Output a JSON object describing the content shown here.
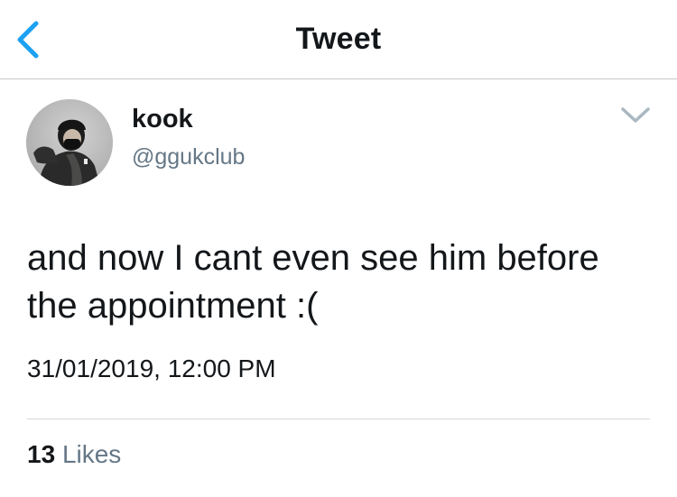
{
  "navbar": {
    "title": "Tweet",
    "back_icon": "chevron-left-icon",
    "accent_color": "#1da1f2"
  },
  "tweet": {
    "author": {
      "display_name": "kook",
      "handle": "@ggukclub"
    },
    "text": "and now I cant even see him before the appointment :(",
    "timestamp": "31/01/2019, 12:00 PM",
    "likes": {
      "count": "13",
      "label": "Likes"
    },
    "menu_icon": "chevron-down-icon"
  },
  "colors": {
    "primary_text": "#14171a",
    "secondary_text": "#657786",
    "divider": "#d8d8dc"
  }
}
